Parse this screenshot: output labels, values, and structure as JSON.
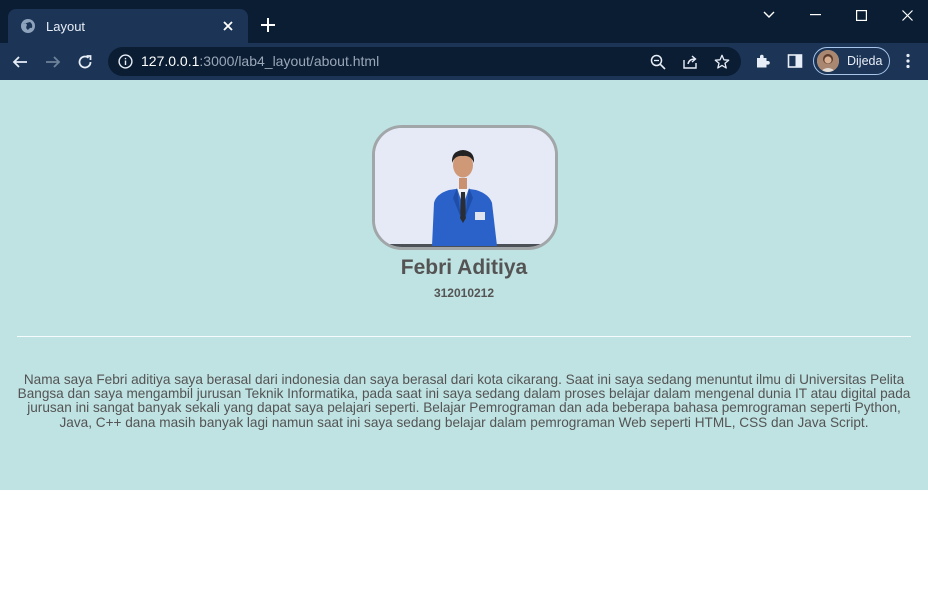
{
  "browser": {
    "tab": {
      "title": "Layout",
      "favicon": "globe-icon",
      "close_icon": "close-icon"
    },
    "new_tab_icon": "plus-icon",
    "window_controls": [
      "chevron-down-icon",
      "minimize-icon",
      "maximize-icon",
      "close-icon"
    ],
    "address": {
      "host": "127.0.0.1",
      "path": ":3000/lab4_layout/about.html"
    },
    "profile": {
      "name": "Dijeda"
    }
  },
  "profile_card": {
    "name": "Febri Aditiya",
    "id": "312010212"
  },
  "about": {
    "text": "Nama saya Febri aditiya saya berasal dari indonesia dan saya berasal dari kota cikarang. Saat ini saya sedang menuntut ilmu di Universitas Pelita Bangsa dan saya mengambil jurusan Teknik Informatika, pada saat ini saya sedang dalam proses belajar dalam mengenal dunia IT atau digital pada jurusan ini sangat banyak sekali yang dapat saya pelajari seperti. Belajar Pemrograman dan ada beberapa bahasa pemrograman seperti Python, Java, C++ dana masih banyak lagi namun saat ini saya sedang belajar dalam pemrograman Web seperti HTML, CSS dan Java Script."
  },
  "colors": {
    "page_background": "#bfe2e2",
    "text": "#545454",
    "browser_frame": "#0b1d33",
    "browser_toolbar": "#1c3556"
  }
}
